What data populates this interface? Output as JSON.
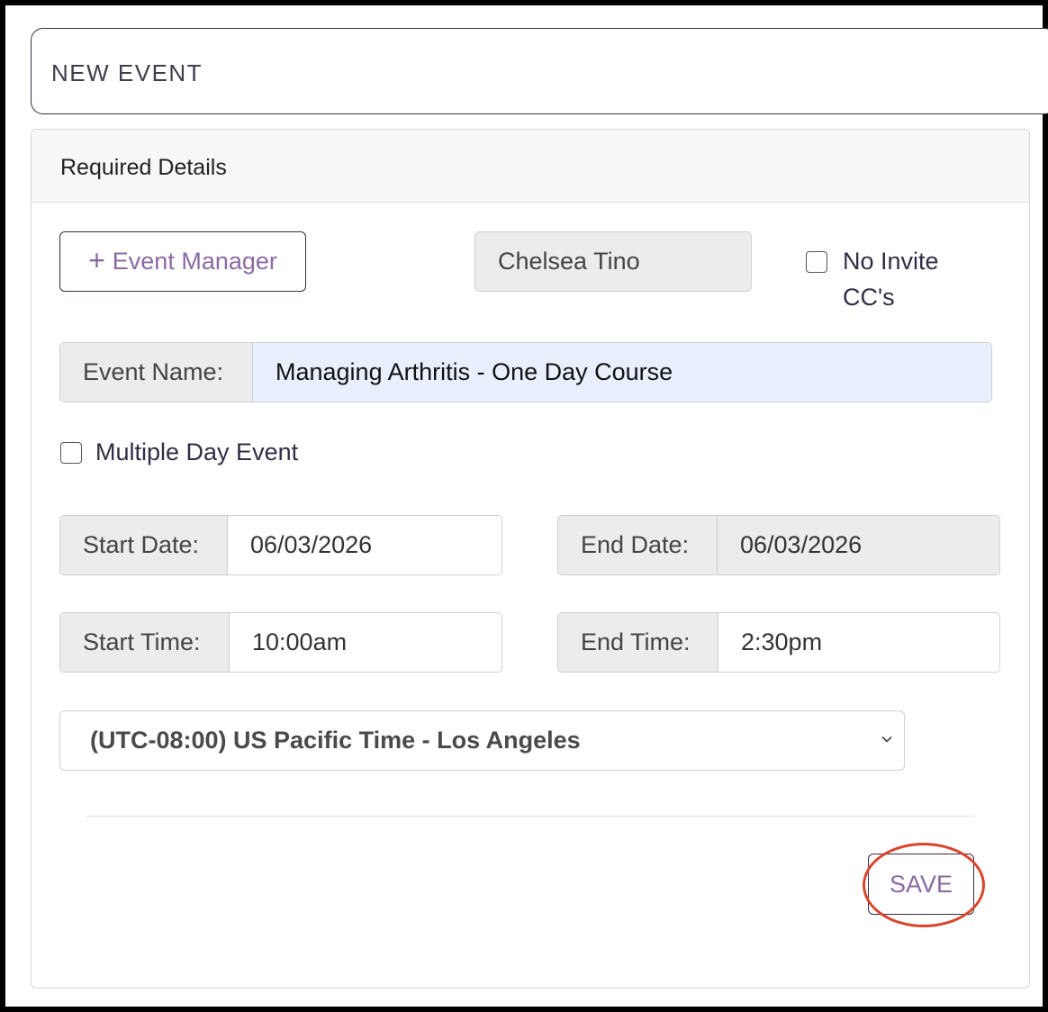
{
  "header": {
    "title": "NEW EVENT"
  },
  "panel": {
    "title": "Required Details"
  },
  "event_manager": {
    "button_label": "Event Manager",
    "selected": "Chelsea Tino"
  },
  "no_invite_cc": {
    "label_line1": "No Invite",
    "label_line2": "CC's",
    "checked": false
  },
  "event_name": {
    "label": "Event Name:",
    "value": "Managing Arthritis - One Day Course"
  },
  "multiple_day": {
    "label": "Multiple Day Event",
    "checked": false
  },
  "start_date": {
    "label": "Start Date:",
    "value": "06/03/2026"
  },
  "end_date": {
    "label": "End Date:",
    "value": "06/03/2026"
  },
  "start_time": {
    "label": "Start Time:",
    "value": "10:00am"
  },
  "end_time": {
    "label": "End Time:",
    "value": "2:30pm"
  },
  "timezone": {
    "selected": "(UTC-08:00) US Pacific Time - Los Angeles"
  },
  "actions": {
    "save_label": "SAVE"
  },
  "colors": {
    "accent": "#8a6aa3",
    "highlight_ring": "#d9452b",
    "input_highlight": "#e8f0fe"
  }
}
